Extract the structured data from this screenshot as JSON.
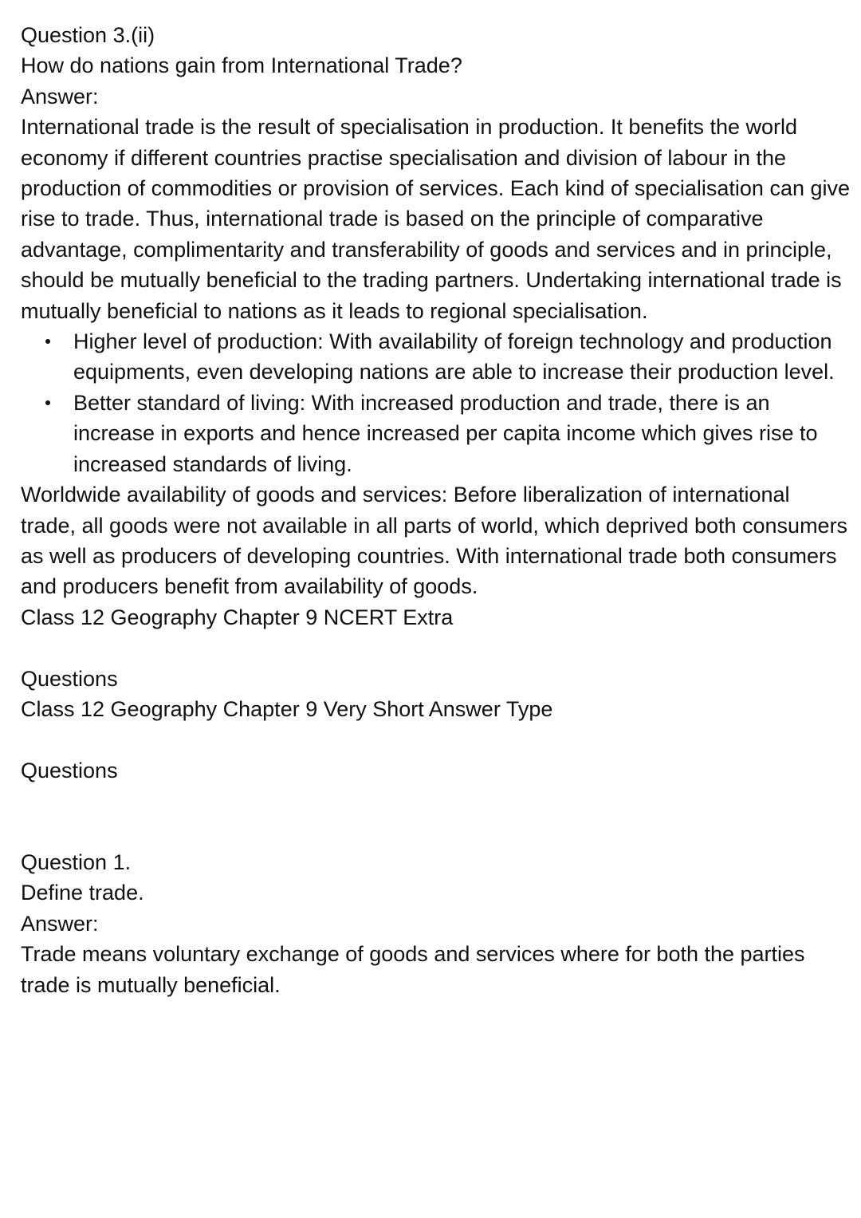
{
  "q3": {
    "label": "Question 3.(ii)",
    "question": "How do nations gain from International Trade?",
    "answer_label": "Answer:",
    "answer_text": "International trade is the result of specialisation in production. It benefits the world economy if different countries practise specialisation and division of labour in the production of commodities or provision of services. Each kind of specialisation can give rise to trade. Thus, international trade is based on the principle of comparative advantage, complimentarity and transferability of goods and services and in principle, should be mutually beneficial to the trading partners. Undertaking international trade is mutually beneficial to nations as it leads to regional specialisation.",
    "bullets": [
      "Higher level of production: With availability of foreign technology and production equipments, even developing nations are able to increase their production level.",
      "Better standard of living: With increased production and trade, there is an increase in exports and hence increased per capita income which gives rise to increased standards of living."
    ],
    "closing_text": "Worldwide availability of goods and services: Before liberalization of international trade, all goods were not available in all parts of world, which deprived both consumers as well as producers of developing countries. With international trade both consumers and producers benefit from availability of goods."
  },
  "section_1": {
    "title": "Class 12 Geography Chapter 9 NCERT Extra",
    "subtitle": "Questions"
  },
  "section_2": {
    "title": "Class 12 Geography Chapter 9 Very Short Answer Type",
    "subtitle": "Questions"
  },
  "q1": {
    "label": "Question 1.",
    "question": "Define trade.",
    "answer_label": "Answer:",
    "answer_text": "Trade means voluntary exchange of goods and services where for both the parties trade is mutually beneficial."
  }
}
